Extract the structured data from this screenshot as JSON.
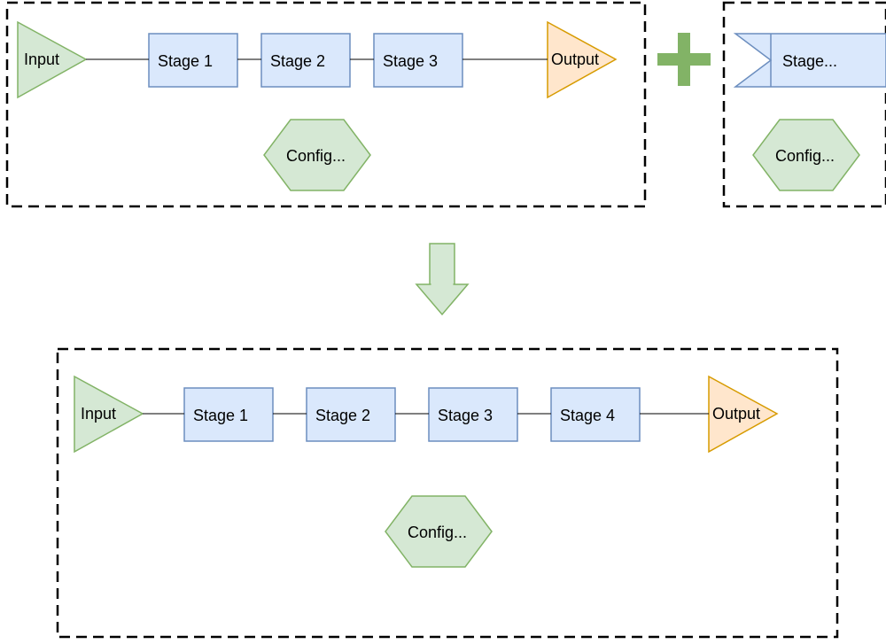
{
  "colors": {
    "green_fill": "#d5e8d4",
    "green_stroke": "#82b366",
    "blue_fill": "#dae8fc",
    "blue_stroke": "#6c8ebf",
    "orange_fill": "#ffe6cc",
    "orange_stroke": "#d79b00",
    "dash_stroke": "#000000"
  },
  "top_left": {
    "input": "Input",
    "stage1": "Stage 1",
    "stage2": "Stage 2",
    "stage3": "Stage 3",
    "output": "Output",
    "config": "Config..."
  },
  "top_right": {
    "stage": "Stage...",
    "config": "Config..."
  },
  "bottom": {
    "input": "Input",
    "stage1": "Stage 1",
    "stage2": "Stage 2",
    "stage3": "Stage 3",
    "stage4": "Stage 4",
    "output": "Output",
    "config": "Config..."
  }
}
